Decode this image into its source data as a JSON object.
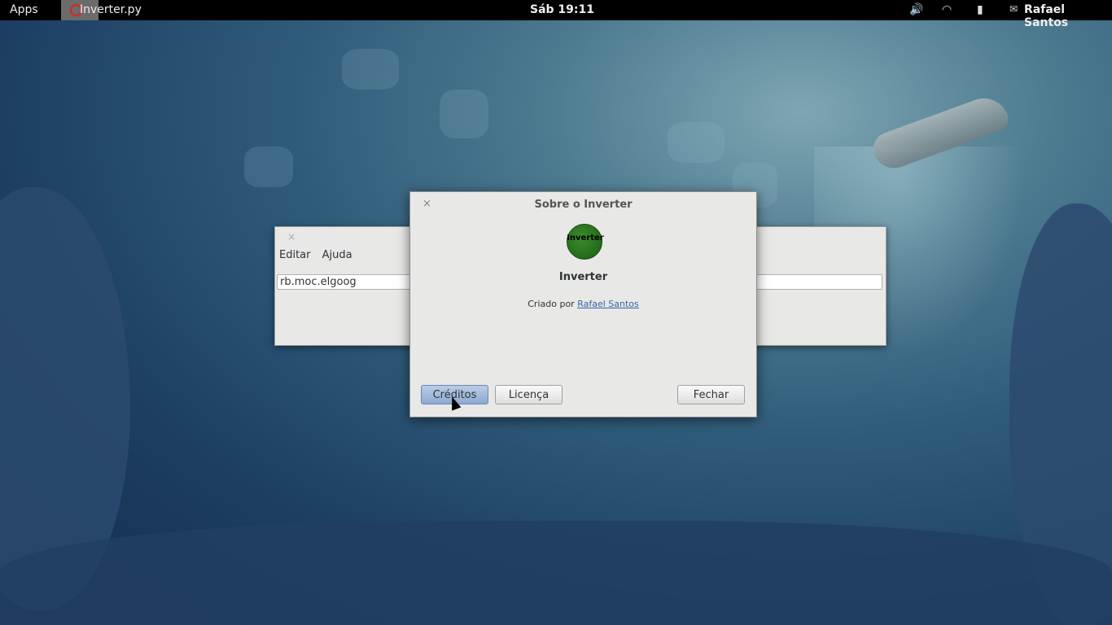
{
  "topbar": {
    "apps_label": "Apps",
    "active_app": "Inverter.py",
    "clock": "Sáb 19:11",
    "volume_icon": "speaker-icon",
    "wifi_icon": "wifi-icon",
    "battery_icon": "battery-icon",
    "user": "Rafael Santos"
  },
  "main_window": {
    "menu": [
      "Editar",
      "Ajuda"
    ],
    "entry_value": "rb.moc.elgoog"
  },
  "about_dialog": {
    "title": "Sobre o Inverter",
    "logo_text": "Inverter",
    "app_name": "Inverter",
    "created_by_label": "Criado por",
    "author": "Rafael Santos",
    "buttons": {
      "credits": "Créditos",
      "license": "Licença",
      "close": "Fechar"
    }
  }
}
